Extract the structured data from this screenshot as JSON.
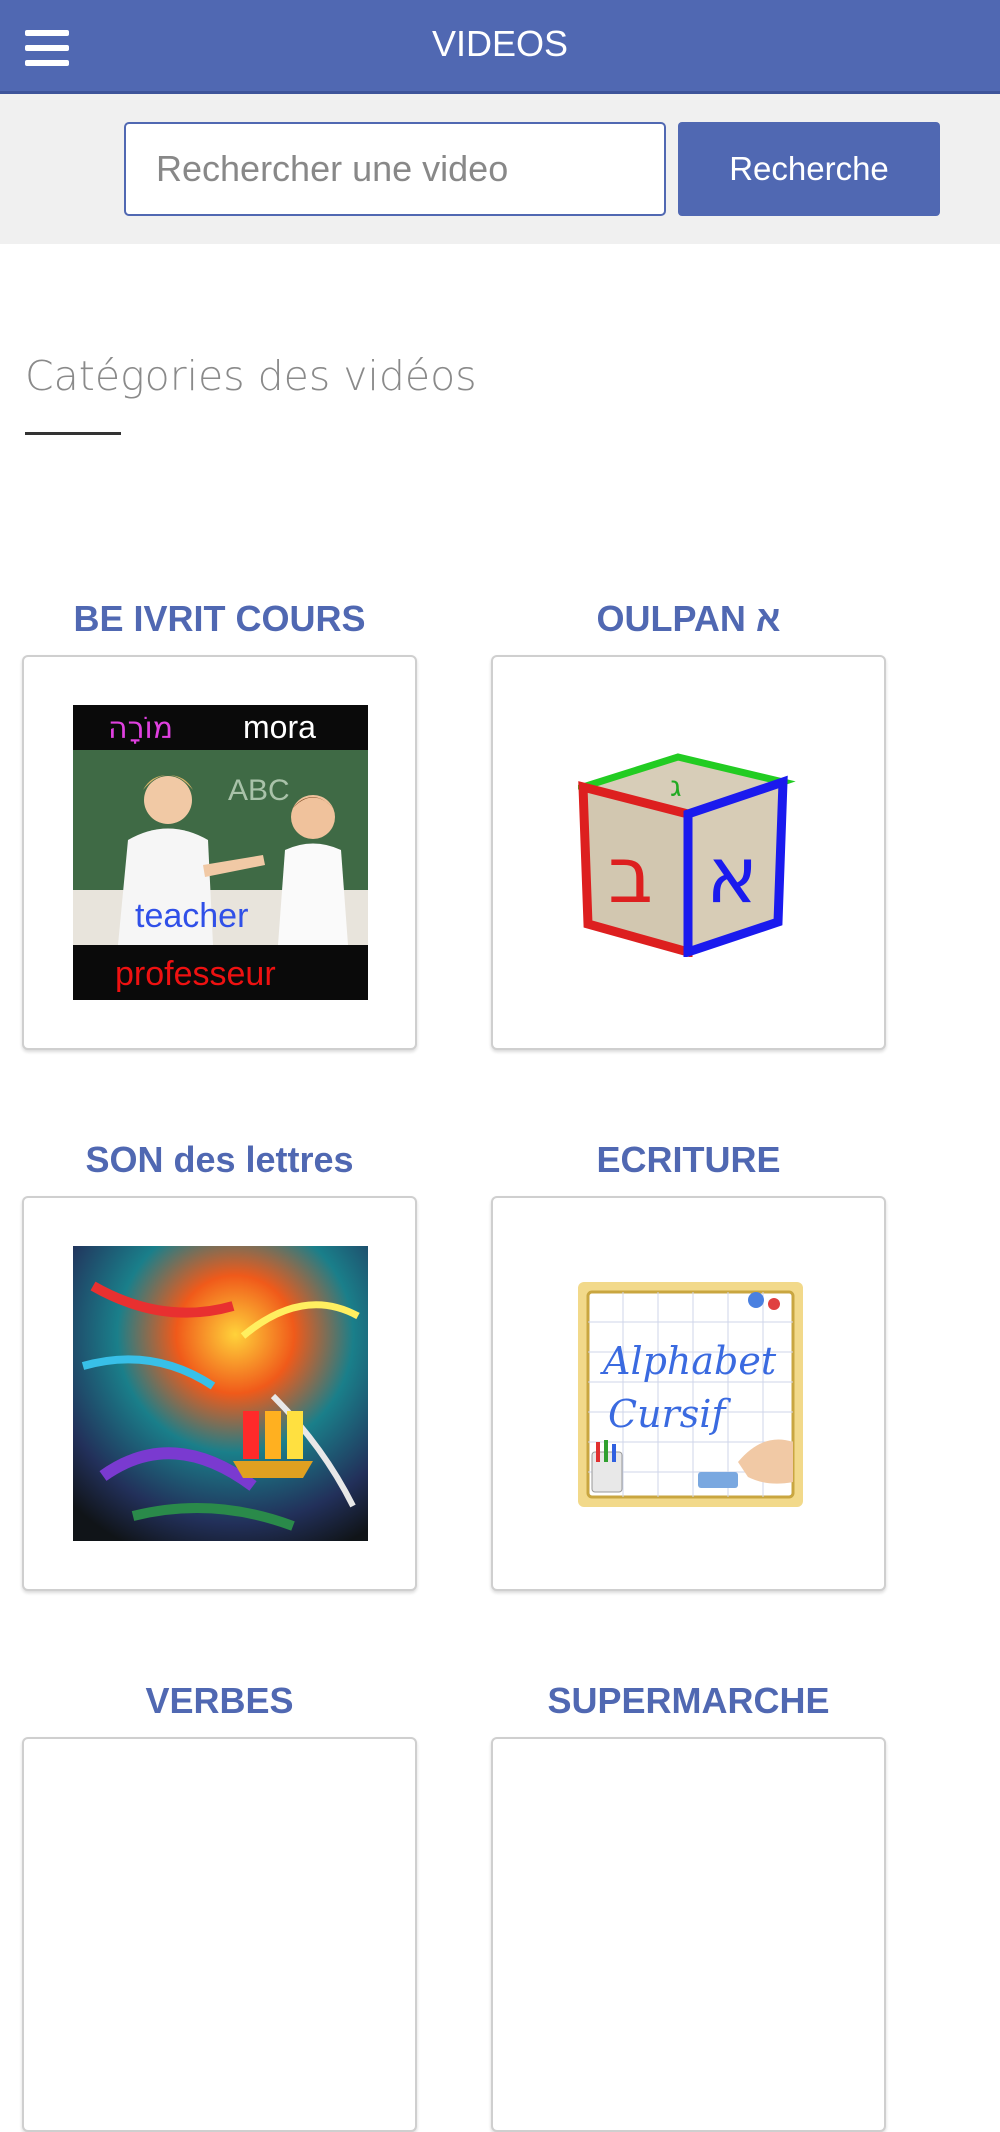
{
  "header": {
    "title": "VIDEOS",
    "menu_icon": "hamburger-menu-icon"
  },
  "search": {
    "placeholder": "Rechercher une video",
    "button_label": "Recherche"
  },
  "section": {
    "title": "Catégories des vidéos"
  },
  "categories": [
    {
      "label": "BE IVRIT COURS",
      "image_texts": {
        "hebrew": "מוֹרָה",
        "english": "mora",
        "board": "ABC",
        "teacher": "teacher",
        "professeur": "professeur"
      }
    },
    {
      "label": "OULPAN א",
      "image_texts": {
        "front": "ב",
        "side": "א",
        "top": "ג"
      }
    },
    {
      "label": "SON des lettres"
    },
    {
      "label": "ECRITURE",
      "image_texts": {
        "line1": "Alphabet",
        "line2": "Cursif"
      }
    },
    {
      "label": "VERBES"
    },
    {
      "label": "SUPERMARCHE"
    }
  ],
  "colors": {
    "brand": "#5068b2",
    "searchbar_bg": "#f0f0f0",
    "title_gray": "#8a8a8a"
  }
}
